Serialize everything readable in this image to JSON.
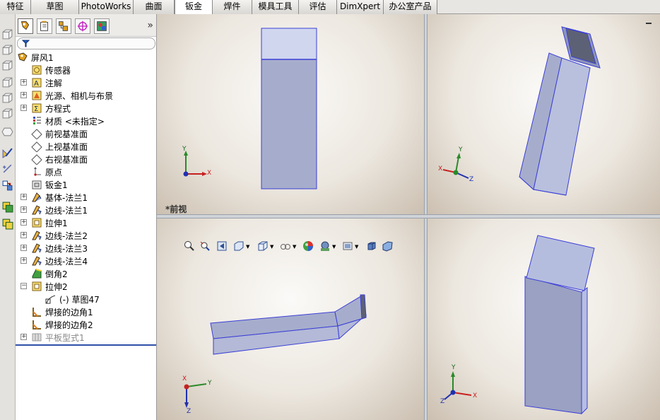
{
  "tabs": [
    {
      "label": "特征",
      "active": false
    },
    {
      "label": "草图",
      "active": false
    },
    {
      "label": "PhotoWorks",
      "active": false
    },
    {
      "label": "曲面",
      "active": false
    },
    {
      "label": "钣金",
      "active": true
    },
    {
      "label": "焊件",
      "active": false
    },
    {
      "label": "模具工具",
      "active": false
    },
    {
      "label": "评估",
      "active": false
    },
    {
      "label": "DimXpert",
      "active": false
    },
    {
      "label": "办公室产品",
      "active": false
    }
  ],
  "feature_manager": {
    "more_label": "»",
    "tree": [
      {
        "label": "屏风1",
        "icon": "part-icon",
        "expander": ""
      },
      {
        "label": "传感器",
        "icon": "sensor-icon",
        "expander": ""
      },
      {
        "label": "注解",
        "icon": "annotation-icon",
        "expander": "+"
      },
      {
        "label": "光源、相机与布景",
        "icon": "lights-icon",
        "expander": "+"
      },
      {
        "label": "方程式",
        "icon": "equation-icon",
        "expander": "+"
      },
      {
        "label": "材质 <未指定>",
        "icon": "material-icon",
        "expander": ""
      },
      {
        "label": "前视基准面",
        "icon": "plane-icon",
        "expander": ""
      },
      {
        "label": "上视基准面",
        "icon": "plane-icon",
        "expander": ""
      },
      {
        "label": "右视基准面",
        "icon": "plane-icon",
        "expander": ""
      },
      {
        "label": "原点",
        "icon": "origin-icon",
        "expander": ""
      },
      {
        "label": "钣金1",
        "icon": "sheetmetal-icon",
        "expander": ""
      },
      {
        "label": "基体-法兰1",
        "icon": "base-flange-icon",
        "expander": "+"
      },
      {
        "label": "边线-法兰1",
        "icon": "edge-flange-icon",
        "expander": "+"
      },
      {
        "label": "拉伸1",
        "icon": "extrude-icon",
        "expander": "+"
      },
      {
        "label": "边线-法兰2",
        "icon": "edge-flange-icon",
        "expander": "+"
      },
      {
        "label": "边线-法兰3",
        "icon": "edge-flange-icon",
        "expander": "+"
      },
      {
        "label": "边线-法兰4",
        "icon": "edge-flange-icon",
        "expander": "+"
      },
      {
        "label": "倒角2",
        "icon": "chamfer-icon",
        "expander": ""
      },
      {
        "label": "拉伸2",
        "icon": "extrude-icon",
        "expander": "−"
      },
      {
        "label": "(-) 草图47",
        "icon": "sketch-icon",
        "expander": "",
        "child": true
      },
      {
        "label": "焊接的边角1",
        "icon": "welded-corner-icon",
        "expander": ""
      },
      {
        "label": "焊接的边角2",
        "icon": "welded-corner-icon",
        "expander": ""
      },
      {
        "label": "平板型式1",
        "icon": "flat-pattern-icon",
        "expander": "+",
        "suppressed": true
      }
    ]
  },
  "viewports": {
    "front_view_label": "*前视",
    "axis_labels": {
      "x": "X",
      "y": "Y",
      "z": "Z"
    }
  },
  "colors": {
    "part_face": "#a6adcc",
    "part_edge": "#3b3fd6",
    "active_tab": "#ffffff",
    "rollback_bar": "#3050a8"
  }
}
